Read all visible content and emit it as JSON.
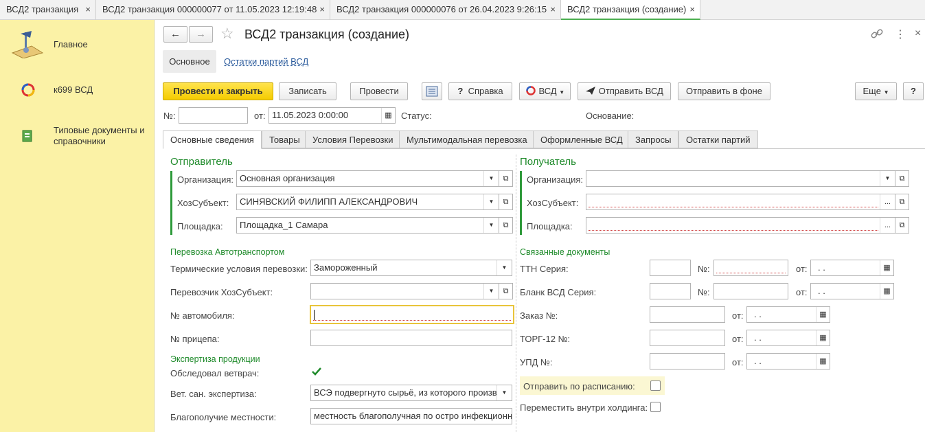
{
  "window_tabs": [
    {
      "label": "ВСД2 транзакция",
      "close": "×"
    },
    {
      "label": "ВСД2 транзакция 000000077 от 11.05.2023 12:19:48",
      "close": "×"
    },
    {
      "label": "ВСД2 транзакция 000000076 от 26.04.2023 9:26:15",
      "close": "×"
    },
    {
      "label": "ВСД2 транзакция (создание)",
      "close": "×"
    }
  ],
  "sidebar": {
    "items": [
      {
        "label": "Главное",
        "icon": "desk-lamp-icon"
      },
      {
        "label": "к699 ВСД",
        "icon": "vetis-logo-icon"
      },
      {
        "label": "Типовые документы и справочники",
        "icon": "book-icon"
      }
    ]
  },
  "header": {
    "title": "ВСД2 транзакция (создание)",
    "back": "←",
    "forward": "→",
    "star": "☆",
    "link_icon": "🔗",
    "more_icon": "⋮",
    "close_icon": "×"
  },
  "nav_tabs": {
    "main": "Основное",
    "remains": "Остатки партий ВСД"
  },
  "toolbar": {
    "post_close": "Провести и закрыть",
    "save": "Записать",
    "post": "Провести",
    "help": "Справка",
    "help_q": "?",
    "vsd": "ВСД",
    "send_vsd": "Отправить ВСД",
    "send_bg": "Отправить в фоне",
    "more": "Еще",
    "q": "?"
  },
  "doc": {
    "num_label": "№:",
    "num_value": "",
    "date_label": "от:",
    "date_value": "11.05.2023  0:00:00",
    "status_label": "Статус:",
    "basis_label": "Основание:"
  },
  "form_tabs": [
    "Основные сведения",
    "Товары",
    "Условия Перевозки",
    "Мультимодальная перевозка",
    "Оформленные ВСД",
    "Запросы",
    "Остатки партий"
  ],
  "sender": {
    "title": "Отправитель",
    "org_label": "Организация:",
    "org_value": "Основная организация",
    "subj_label": "ХозСубъект:",
    "subj_value": "СИНЯВСКИЙ ФИЛИПП АЛЕКСАНДРОВИЧ",
    "site_label": "Площадка:",
    "site_value": "Площадка_1 Самара"
  },
  "receiver": {
    "title": "Получатель",
    "org_label": "Организация:",
    "org_value": "",
    "subj_label": "ХозСубъект:",
    "subj_value": "",
    "site_label": "Площадка:",
    "site_value": ""
  },
  "transport": {
    "title": "Перевозка Автотранспортом",
    "thermo_label": "Термические условия перевозки:",
    "thermo_value": "Замороженный",
    "carrier_label": "Перевозчик ХозСубъект:",
    "carrier_value": "",
    "car_label": "№ автомобиля:",
    "car_value": "",
    "trailer_label": "№ прицепа:",
    "trailer_value": ""
  },
  "expertise": {
    "title": "Экспертиза продукции",
    "vet_label": "Обследовал ветврач:",
    "vet_checked": true,
    "san_label": "Вет. сан. экспертиза:",
    "san_value": "ВСЭ подвергнуто сырьё, из которого произв",
    "wellbeing_label": "Благополучие местности:",
    "wellbeing_value": "местность благополучная по остро инфекционн"
  },
  "related": {
    "title": "Связанные документы",
    "ttn_label": "ТТН Серия:",
    "blank_label": "Бланк ВСД Серия:",
    "order_label": "Заказ №:",
    "torg_label": "ТОРГ-12 №:",
    "upd_label": "УПД №:",
    "num_label": "№:",
    "from_label": "от:",
    "date_placeholder": " .  ."
  },
  "schedule": {
    "send_label": "Отправить по расписанию:",
    "move_label": "Переместить внутри холдинга:"
  },
  "glyphs": {
    "dd": "▼",
    "open": "⧉",
    "dots": "...",
    "cal": "▦",
    "check": "✓",
    "lines": "☰"
  }
}
